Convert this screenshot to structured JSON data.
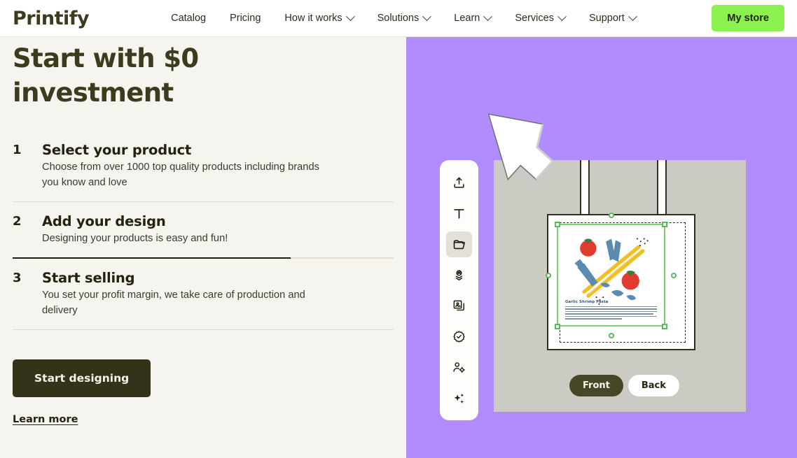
{
  "nav": {
    "logo": "Printify",
    "items": [
      {
        "label": "Catalog",
        "has_dropdown": false
      },
      {
        "label": "Pricing",
        "has_dropdown": false
      },
      {
        "label": "How it works",
        "has_dropdown": true
      },
      {
        "label": "Solutions",
        "has_dropdown": true
      },
      {
        "label": "Learn",
        "has_dropdown": true
      },
      {
        "label": "Services",
        "has_dropdown": true
      },
      {
        "label": "Support",
        "has_dropdown": true
      }
    ],
    "cta_label": "My store",
    "cta_color": "#8af14f"
  },
  "hero": {
    "headline": "Start with $0 investment",
    "steps": [
      {
        "num": "1",
        "title": "Select your product",
        "desc": "Choose from over 1000 top quality products including brands you know and love"
      },
      {
        "num": "2",
        "title": "Add your design",
        "desc": "Designing your products is easy and fun!"
      },
      {
        "num": "3",
        "title": "Start selling",
        "desc": "You set your profit margin, we take care of production and delivery"
      }
    ],
    "progress_percent": "73",
    "cta_label": "Start designing",
    "secondary_link": "Learn more"
  },
  "editor": {
    "background_color": "#b18cfc",
    "canvas_color": "#cbcbc3",
    "tools": [
      {
        "name": "upload-icon",
        "label": "Upload"
      },
      {
        "name": "text-icon",
        "label": "Text"
      },
      {
        "name": "folder-icon",
        "label": "My files",
        "active": true
      },
      {
        "name": "graphics-icon",
        "label": "Graphics"
      },
      {
        "name": "layers-icon",
        "label": "Layers"
      },
      {
        "name": "badge-check-icon",
        "label": "Quality"
      },
      {
        "name": "personalize-icon",
        "label": "Personalize"
      },
      {
        "name": "sparkles-icon",
        "label": "AI image generator"
      }
    ],
    "design": {
      "recipe_title": "Garlic Shrimp Pasta",
      "accent_color": "#7ccf6e"
    },
    "side_toggle": {
      "options": [
        "Front",
        "Back"
      ],
      "selected": "Front"
    }
  }
}
